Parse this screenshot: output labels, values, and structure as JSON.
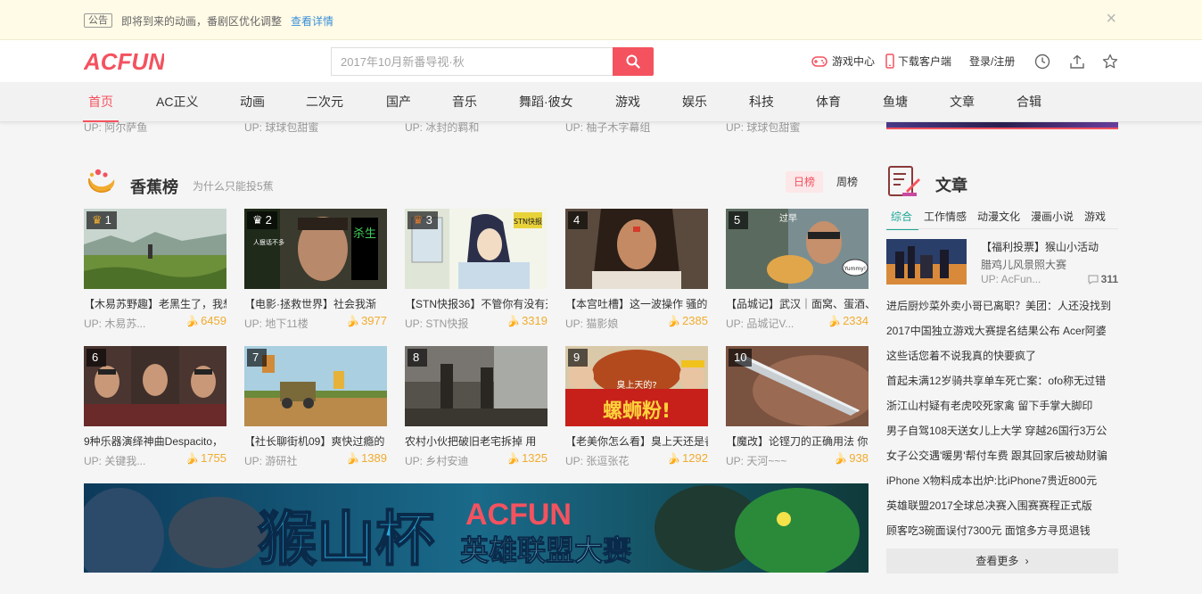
{
  "notice": {
    "tag": "公告",
    "message": "即将到来的动画，番剧区优化调整",
    "link": "查看详情",
    "close": "×"
  },
  "header": {
    "logo_text": "ACFUN",
    "search_placeholder": "2017年10月新番导视·秋",
    "game_center": "游戏中心",
    "download_client": "下载客户端",
    "login": "登录/注册",
    "icons": [
      "history-icon",
      "upload-icon",
      "favorites-icon"
    ]
  },
  "nav": [
    "首页",
    "AC正义",
    "动画",
    "二次元",
    "国产",
    "音乐",
    "舞蹈·彼女",
    "游戏",
    "娱乐",
    "科技",
    "体育",
    "鱼塘",
    "文章",
    "合辑"
  ],
  "cut_row": [
    "UP: 阿尔萨鱼",
    "UP: 球球包甜蜜",
    "UP: 冰封的羁和",
    "UP: 柚子木字幕组",
    "UP: 球球包甜蜜"
  ],
  "ranking": {
    "title": "香蕉榜",
    "subtitle": "为什么只能投5蕉",
    "tab_day": "日榜",
    "tab_week": "周榜",
    "items": [
      {
        "rank": "1",
        "title": "【木易苏野趣】老黑生了，我想",
        "up": "UP:  木易苏...",
        "bananas": "6459"
      },
      {
        "rank": "2",
        "title": "【电影·拯救世界】社会我渐",
        "up": "UP:  地下11楼",
        "bananas": "3977"
      },
      {
        "rank": "3",
        "title": "【STN快报36】不管你有没有开",
        "up": "UP:  STN快报",
        "bananas": "3319"
      },
      {
        "rank": "4",
        "title": "【本宫吐槽】这一波操作  骚的",
        "up": "UP:  猫影娘",
        "bananas": "2385"
      },
      {
        "rank": "5",
        "title": "【品城记】武汉｜面窝、蛋酒、",
        "up": "UP:  品城记V...",
        "bananas": "2334"
      },
      {
        "rank": "6",
        "title": "9种乐器演绎神曲Despacito，",
        "up": "UP:  关键我...",
        "bananas": "1755"
      },
      {
        "rank": "7",
        "title": "【社长聊街机09】爽快过瘾的",
        "up": "UP:  游研社",
        "bananas": "1389"
      },
      {
        "rank": "8",
        "title": "农村小伙把破旧老宅拆掉  用",
        "up": "UP:  乡村安迪",
        "bananas": "1325"
      },
      {
        "rank": "9",
        "title": "【老美你怎么看】臭上天还是香",
        "up": "UP:  张逗张花",
        "bananas": "1292"
      },
      {
        "rank": "10",
        "title": "【魔改】论铿刀的正确用法  你",
        "up": "UP:  天河~~~",
        "bananas": "938"
      }
    ]
  },
  "thumb_captions": {
    "t2_tag": "杀生",
    "t2_side": "人狠话不多",
    "t2_side2": "社会我哥好",
    "t3_logo": "STN快报",
    "t5_sign": "过早",
    "t5_bubble": "Yummy!",
    "t9_top": "臭上天的?",
    "t9_main": "螺蛳粉!"
  },
  "banner": {
    "main": "猴山杯",
    "brand": "ACFUN",
    "sub": "英雄联盟大赛"
  },
  "articles": {
    "title": "文章",
    "tabs": [
      "综合",
      "工作情感",
      "动漫文化",
      "漫画小说",
      "游戏"
    ],
    "featured": {
      "title": "【福利投票】猴山小活动",
      "subtitle": "腊鸡儿风景照大赛",
      "up": "UP:  AcFun...",
      "comments": "311"
    },
    "list": [
      "进后厨炒菜外卖小哥已离职？美团：人还没找到",
      "2017中国独立游戏大赛提名结果公布  Acer阿婆",
      "这些话您着不说我真的快要疯了",
      "首起未满12岁骑共享单车死亡案：ofo称无过错",
      "浙江山村疑有老虎咬死家禽  留下手掌大脚印",
      "男子自驾108天送女儿上大学  穿越26国行3万公",
      "女子公交遇'暖男'帮付车费  跟其回家后被劫财骗",
      "iPhone  X物料成本出炉:比iPhone7贵近800元",
      "英雄联盟2017全球总决赛入围赛赛程正式版",
      "顾客吃3碗面误付7300元  面馆多方寻觅退钱"
    ],
    "more": "查看更多"
  },
  "colors": {
    "accent": "#f4525f",
    "banana": "#f1ab2e",
    "tab_active": "#1aa694"
  }
}
